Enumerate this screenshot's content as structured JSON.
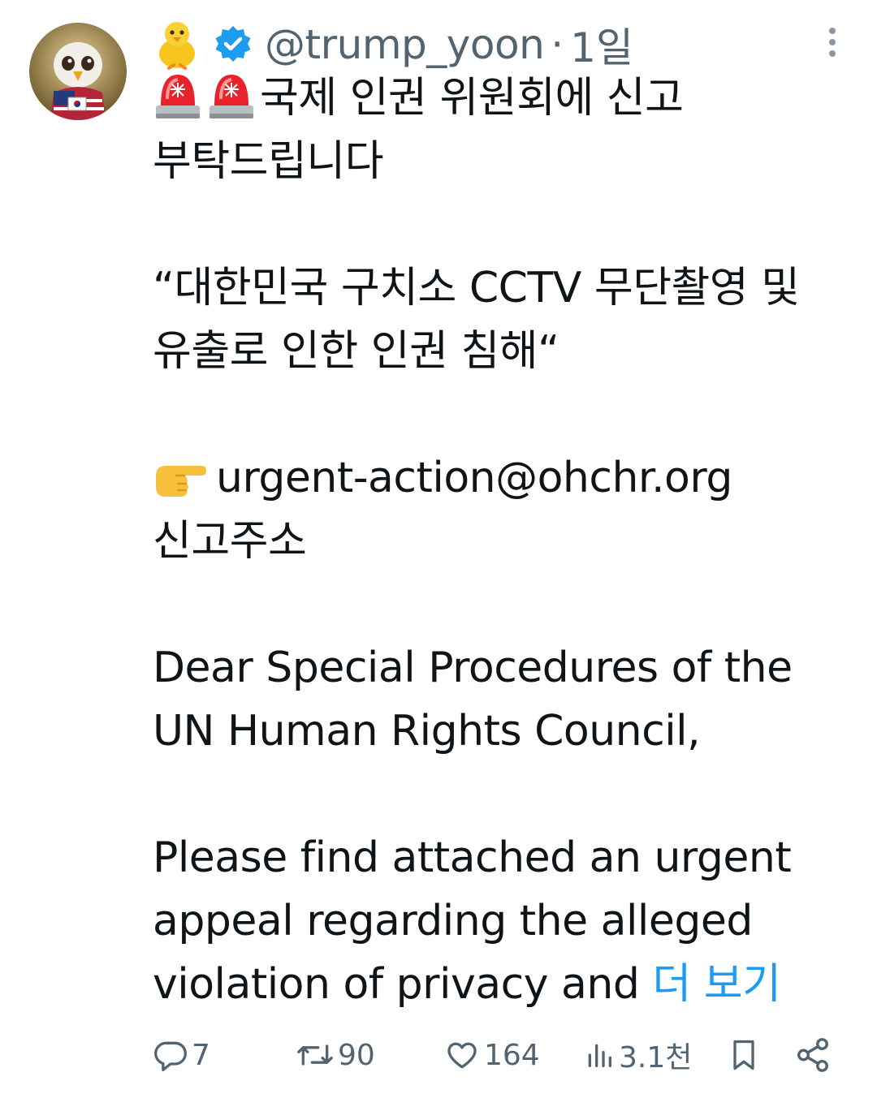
{
  "header": {
    "handle": "@trump_yoon",
    "separator": "·",
    "time": "1일"
  },
  "body": {
    "line1": "국제 인권 위원회에 신고",
    "line2": "부탁드립니다",
    "quote1": "“대한민국 구치소 CCTV 무단촬영 및",
    "quote2": "유출로 인한 인권 침해“",
    "email": "urgent-action@ohchr.org",
    "email_label": "신고주소",
    "p1_line1": "Dear Special Procedures of the",
    "p1_line2": "UN Human Rights Council,",
    "p2_line1": "Please find attached an urgent",
    "p2_line2": "appeal regarding the alleged",
    "p2_line3": "violation of privacy and",
    "show_more": "더 보기"
  },
  "actions": {
    "replies": "7",
    "reposts": "90",
    "likes": "164",
    "views": "3.1천"
  },
  "colors": {
    "text": "#0f1419",
    "secondary": "#536471",
    "link": "#1d9bf0"
  },
  "icons": [
    "avatar-eagle",
    "chick-emoji",
    "verified-badge",
    "more-icon",
    "siren-emoji",
    "pointing-hand-emoji",
    "reply-icon",
    "repost-icon",
    "like-icon",
    "views-icon",
    "bookmark-icon",
    "share-icon"
  ]
}
